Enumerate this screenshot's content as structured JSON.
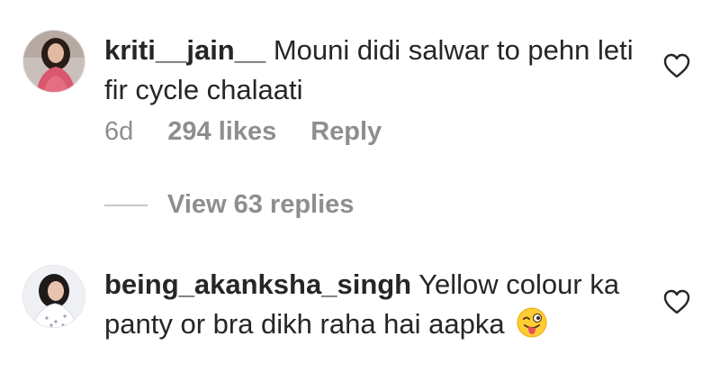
{
  "comments": [
    {
      "username": "kriti__jain__",
      "text": "Mouni didi salwar to pehn leti fir cycle chalaati",
      "time": "6d",
      "likes": "294 likes",
      "reply_label": "Reply",
      "avatar_icon": "user-avatar",
      "like_icon": "heart-outline-icon"
    },
    {
      "username": "being_akanksha_singh",
      "text": "Yellow colour ka panty or bra dikh raha hai aapka",
      "emoji_icon": "winking-face-with-tongue-emoji",
      "avatar_icon": "user-avatar",
      "like_icon": "heart-outline-icon"
    }
  ],
  "view_replies": {
    "label": "View 63 replies"
  },
  "colors": {
    "text": "#262626",
    "muted": "#8e8e8e",
    "divider": "#c7c7c7"
  }
}
